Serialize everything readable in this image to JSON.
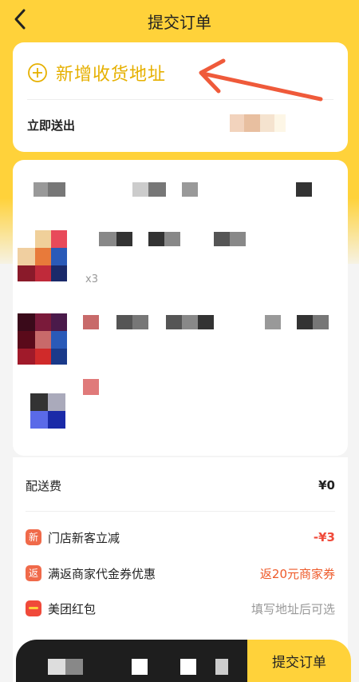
{
  "navbar": {
    "title": "提交订单",
    "back_icon": "chevron-left-icon"
  },
  "address": {
    "add_label": "新增收货地址",
    "add_icon": "circle-plus-icon",
    "deliver_label": "立即送出"
  },
  "goods": {
    "qty": "x3"
  },
  "fees": {
    "delivery_label": "配送费",
    "delivery_value": "¥0",
    "new_customer_badge": "新",
    "new_customer_label": "门店新客立减",
    "new_customer_value": "-¥3",
    "coupon_badge": "返",
    "coupon_label": "满返商家代金券优惠",
    "coupon_value": "返20元商家券",
    "redpacket_label": "美团红包",
    "redpacket_value": "填写地址后可选"
  },
  "bottom": {
    "submit_label": "提交订单"
  },
  "colors": {
    "brand_yellow": "#ffd23a",
    "accent_gold": "#e6b000",
    "arrow_red": "#ef5a3a",
    "price_red": "#f04a3a"
  }
}
